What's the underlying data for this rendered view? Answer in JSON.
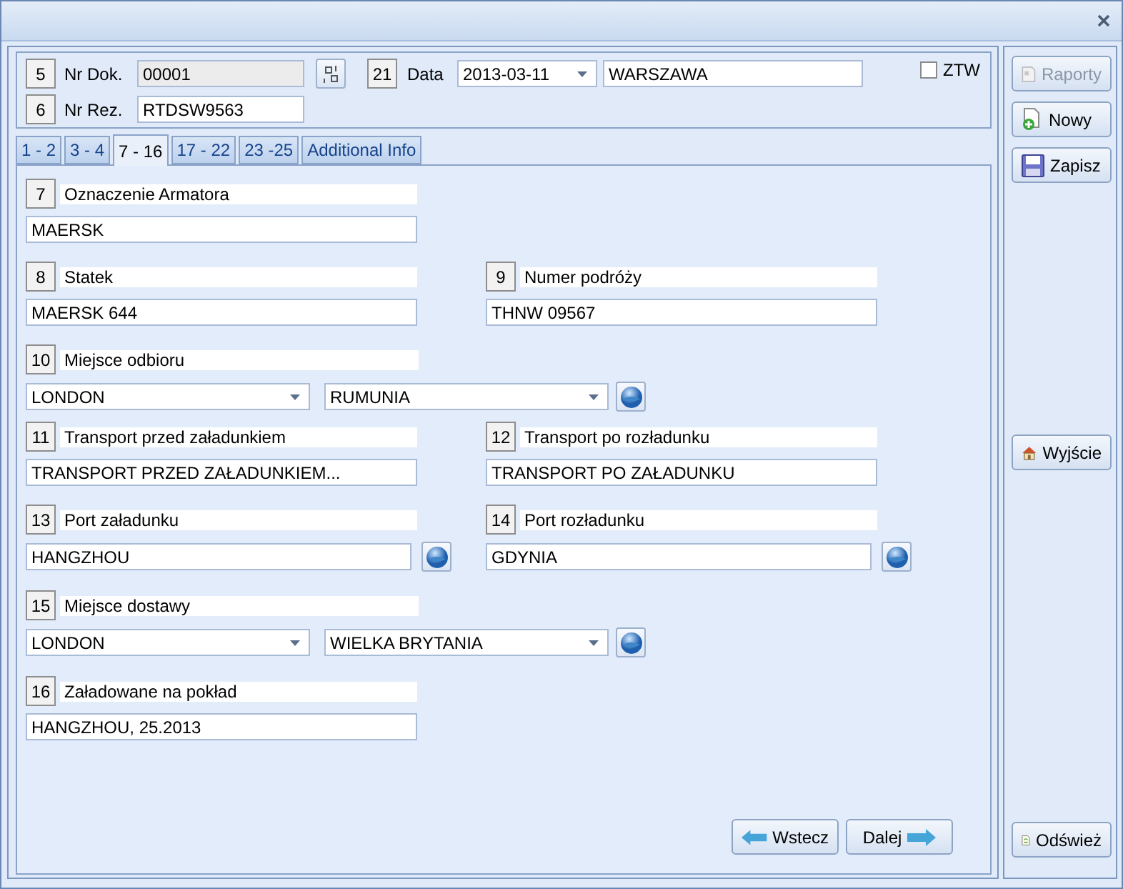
{
  "header": {
    "rows": [
      {
        "number": "5",
        "label": "Nr Dok.",
        "value": "00001",
        "readonly": true,
        "numbering": true
      },
      {
        "number": "6",
        "label": "Nr Rez.",
        "value": "RTDSW9563",
        "readonly": false,
        "numbering": false
      }
    ],
    "date": {
      "number": "21",
      "label": "Data",
      "value": "2013-03-11",
      "place": "WARSZAWA"
    },
    "ztw": {
      "label": "ZTW",
      "checked": false
    }
  },
  "tabs": [
    {
      "label": "1 - 2",
      "selected": false
    },
    {
      "label": "3 - 4",
      "selected": false
    },
    {
      "label": "7 - 16",
      "selected": true
    },
    {
      "label": "17 - 22",
      "selected": false
    },
    {
      "label": "23 -25",
      "selected": false
    },
    {
      "label": "Additional Info",
      "selected": false
    }
  ],
  "rows": [
    [
      {
        "number": "7",
        "label": "Oznaczenie Armatora",
        "lookup": false,
        "inputs": [
          {
            "kind": "text",
            "value": "MAERSK"
          }
        ]
      }
    ],
    [
      {
        "number": "8",
        "label": "Statek",
        "lookup": false,
        "inputs": [
          {
            "kind": "text",
            "value": "MAERSK 644"
          }
        ]
      },
      {
        "number": "9",
        "label": "Numer podróży",
        "lookup": false,
        "inputs": [
          {
            "kind": "text",
            "value": "THNW 09567"
          }
        ]
      }
    ],
    [
      {
        "number": "10",
        "label": "Miejsce odbioru",
        "lookup": true,
        "inputs": [
          {
            "kind": "combo",
            "value": "LONDON"
          },
          {
            "kind": "combo",
            "value": "RUMUNIA"
          }
        ]
      }
    ],
    [
      {
        "number": "11",
        "label": "Transport przed załadunkiem",
        "lookup": false,
        "inputs": [
          {
            "kind": "text",
            "value": "TRANSPORT PRZED ZAŁADUNKIEM..."
          }
        ]
      },
      {
        "number": "12",
        "label": "Transport po rozładunku",
        "lookup": false,
        "inputs": [
          {
            "kind": "text",
            "value": "TRANSPORT PO ZAŁADUNKU"
          }
        ]
      }
    ],
    [
      {
        "number": "13",
        "label": "Port załadunku",
        "lookup": true,
        "inputs": [
          {
            "kind": "text",
            "value": "HANGZHOU"
          }
        ]
      },
      {
        "number": "14",
        "label": "Port rozładunku",
        "lookup": true,
        "inputs": [
          {
            "kind": "text",
            "value": "GDYNIA"
          }
        ]
      }
    ],
    [
      {
        "number": "15",
        "label": "Miejsce dostawy",
        "lookup": true,
        "inputs": [
          {
            "kind": "combo",
            "value": "LONDON"
          },
          {
            "kind": "combo",
            "value": "WIELKA BRYTANIA"
          }
        ]
      }
    ],
    [
      {
        "number": "16",
        "label": "Załadowane na pokład",
        "lookup": false,
        "inputs": [
          {
            "kind": "text",
            "value": "HANGZHOU, 25.2013"
          }
        ]
      }
    ]
  ],
  "nav": [
    {
      "label": "Wstecz",
      "kind": "back"
    },
    {
      "label": "Dalej",
      "kind": "next"
    }
  ],
  "sidebar": {
    "actions": [
      {
        "label": "Raporty",
        "kind": "report",
        "disabled": true
      },
      {
        "label": "Nowy",
        "kind": "new",
        "disabled": false
      },
      {
        "label": "Zapisz",
        "kind": "save",
        "disabled": false
      }
    ],
    "exit": {
      "label": "Wyjście",
      "kind": "home",
      "disabled": false
    },
    "refresh": {
      "label": "Odśwież",
      "kind": "refresh",
      "disabled": false
    }
  }
}
